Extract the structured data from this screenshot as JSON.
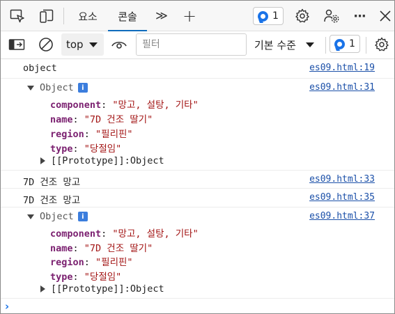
{
  "tabs": [
    {
      "label": "요소"
    },
    {
      "label": "콘솔"
    }
  ],
  "tabbar": {
    "issues_count": "1",
    "more_tabs_label": "≫",
    "add_tab_label": "+",
    "more_label": "···"
  },
  "toolbar": {
    "context_value": "top",
    "filter_placeholder": "필터",
    "levels_label": "기본 수준",
    "issues_count": "1"
  },
  "console": {
    "messages": [
      {
        "text": "object",
        "source": "es09.html:19"
      },
      {
        "object_label": "Object",
        "info_badge": "i",
        "source": "es09.html:31",
        "props": [
          {
            "key": "component",
            "value": "\"망고, 설탕, 기타\""
          },
          {
            "key": "name",
            "value": "\"7D 건조 딸기\""
          },
          {
            "key": "region",
            "value": "\"필리핀\""
          },
          {
            "key": "type",
            "value": "\"당절임\""
          }
        ],
        "proto_key": "[[Prototype]]",
        "proto_value": "Object"
      },
      {
        "text": "7D 건조 망고",
        "source": "es09.html:33"
      },
      {
        "text": "7D 건조 망고",
        "source": "es09.html:35"
      },
      {
        "object_label": "Object",
        "info_badge": "i",
        "source": "es09.html:37",
        "props": [
          {
            "key": "component",
            "value": "\"망고, 설탕, 기타\""
          },
          {
            "key": "name",
            "value": "\"7D 건조 딸기\""
          },
          {
            "key": "region",
            "value": "\"필리핀\""
          },
          {
            "key": "type",
            "value": "\"당절임\""
          }
        ],
        "proto_key": "[[Prototype]]",
        "proto_value": "Object"
      }
    ],
    "prompt": "›"
  },
  "colors": {
    "accent": "#0f6cbd",
    "link": "#1a4fa8",
    "prop_key": "#7a1f6f",
    "string_value": "#a31515",
    "badge_blue": "#1a73e8"
  }
}
